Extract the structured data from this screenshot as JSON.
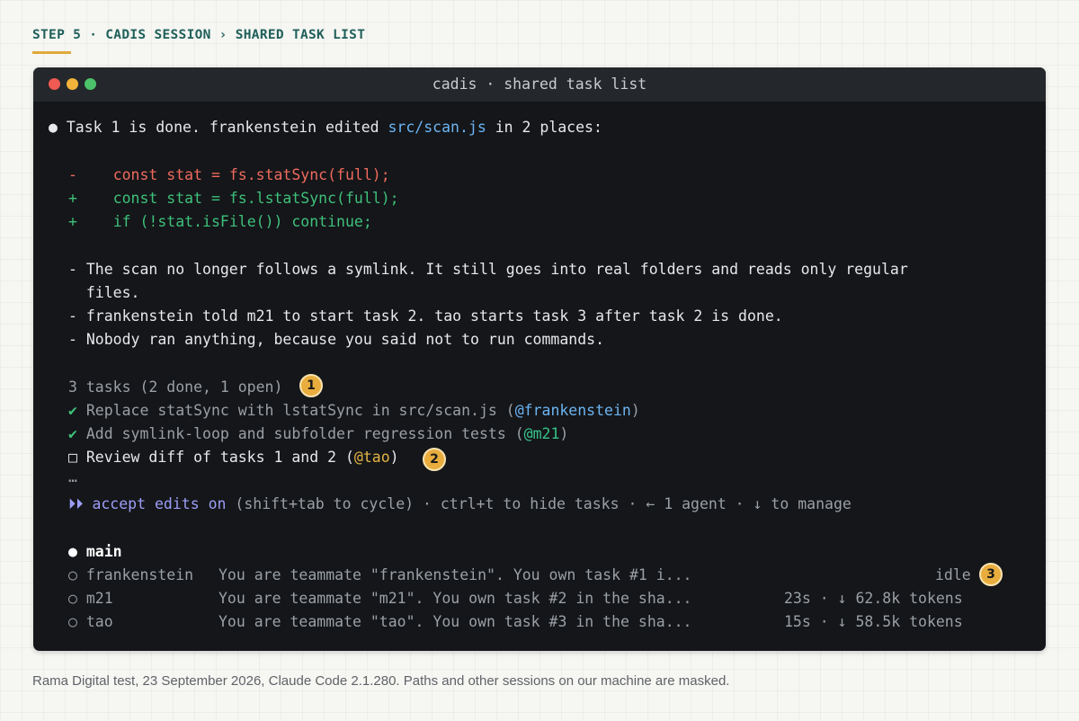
{
  "breadcrumb": "STEP 5 · CADIS SESSION › SHARED TASK LIST",
  "window": {
    "title": "cadis · shared task list"
  },
  "summary": {
    "bullet": "●",
    "prefix": "Task 1 is done. frankenstein edited ",
    "file": "src/scan.js",
    "suffix": " in 2 places:"
  },
  "diff": [
    {
      "sign": "-",
      "code": "const stat = fs.statSync(full);"
    },
    {
      "sign": "+",
      "code": "const stat = fs.lstatSync(full);"
    },
    {
      "sign": "+",
      "code": "if (!stat.isFile()) continue;"
    }
  ],
  "notes": [
    "- The scan no longer follows a symlink. It still goes into real folders and reads only regular",
    "  files.",
    "- frankenstein told m21 to start task 2. tao starts task 3 after task 2 is done.",
    "- Nobody ran anything, because you said not to run commands."
  ],
  "tasks": {
    "header": "3 tasks (2 done, 1 open)",
    "items": [
      {
        "mark": "✔",
        "text": "Replace statSync with lstatSync in src/scan.js (",
        "owner": "@frankenstein",
        "close": ")"
      },
      {
        "mark": "✔",
        "text": "Add symlink-loop and subfolder regression tests (",
        "owner": "@m21",
        "close": ")"
      },
      {
        "mark": "□",
        "text": "Review diff of tasks 1 and 2 (",
        "owner": "@tao",
        "close": ")"
      }
    ],
    "more": "…"
  },
  "mode_line": {
    "arrows": "⏵⏵",
    "mode": "accept edits on",
    "rest": " (shift+tab to cycle) · ctrl+t to hide tasks · ← 1 agent · ↓ to manage"
  },
  "agents": {
    "main": {
      "bullet": "●",
      "name": "main"
    },
    "list": [
      {
        "bullet": "○",
        "name": "frankenstein",
        "prompt": "You are teammate \"frankenstein\". You own task #1 i...",
        "status": "idle"
      },
      {
        "bullet": "○",
        "name": "m21",
        "prompt": "You are teammate \"m21\". You own task #2 in the sha...",
        "status": "23s · ↓ 62.8k tokens"
      },
      {
        "bullet": "○",
        "name": "tao",
        "prompt": "You are teammate \"tao\". You own task #3 in the sha...",
        "status": "15s · ↓ 58.5k tokens"
      }
    ]
  },
  "badges": [
    "1",
    "2",
    "3"
  ],
  "caption": "Rama Digital test, 23 September 2026, Claude Code 2.1.280. Paths and other sessions on our machine are masked.",
  "colors": {
    "accent_teal": "#1f5f5a",
    "badge": "#e9ad3e",
    "diff_removed": "#ef6a5e",
    "diff_added": "#3fc07a",
    "file_link": "#6cb4f2",
    "mode": "#9d9df7"
  }
}
